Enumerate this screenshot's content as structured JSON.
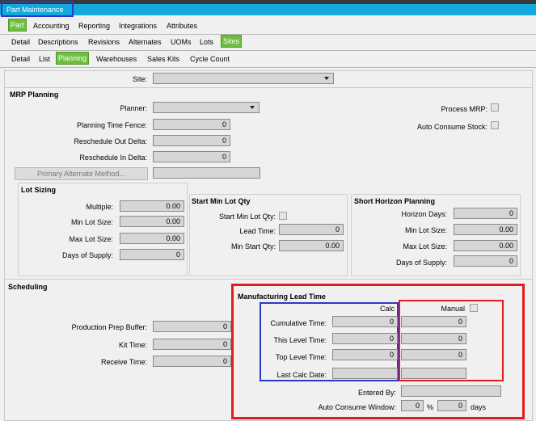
{
  "window": {
    "title": "Part Maintenance"
  },
  "tabs_level1": [
    "Part",
    "Accounting",
    "Reporting",
    "Integrations",
    "Attributes"
  ],
  "tabs_level2": [
    "Detail",
    "Descriptions",
    "Revisions",
    "Alternates",
    "UOMs",
    "Lots",
    "Sites"
  ],
  "tabs_level3": [
    "Detail",
    "List",
    "Planning",
    "Warehouses",
    "Sales Kits",
    "Cycle Count"
  ],
  "site": {
    "label": "Site:",
    "value": ""
  },
  "mrp": {
    "section": "MRP Planning",
    "planner_label": "Planner:",
    "planning_time_fence_label": "Planning Time Fence:",
    "planning_time_fence": "0",
    "reschedule_out_label": "Reschedule Out Delta:",
    "reschedule_out": "0",
    "reschedule_in_label": "Reschedule In Delta:",
    "reschedule_in": "0",
    "primary_alt_button": "Primary Alternate Method...",
    "process_mrp_label": "Process MRP:",
    "auto_consume_label": "Auto Consume Stock:"
  },
  "lot_sizing": {
    "section": "Lot Sizing",
    "multiple_label": "Multiple:",
    "multiple": "0.00",
    "min_lot_label": "Min Lot Size:",
    "min_lot": "0.00",
    "max_lot_label": "Max Lot Size:",
    "max_lot": "0.00",
    "days_supply_label": "Days of Supply:",
    "days_supply": "0"
  },
  "start_min": {
    "section": "Start Min Lot Qty",
    "start_min_label": "Start Min Lot Qty:",
    "lead_time_label": "Lead Time:",
    "lead_time": "0",
    "min_start_label": "Min Start Qty:",
    "min_start": "0.00"
  },
  "short_horizon": {
    "section": "Short Horizon Planning",
    "horizon_label": "Horizon Days:",
    "horizon": "0",
    "min_lot_label": "Min Lot Size:",
    "min_lot": "0.00",
    "max_lot_label": "Max Lot Size:",
    "max_lot": "0.00",
    "days_supply_label": "Days of Supply:",
    "days_supply": "0"
  },
  "scheduling": {
    "section": "Scheduling",
    "prod_prep_label": "Production Prep Buffer:",
    "prod_prep": "0",
    "kit_time_label": "Kit Time:",
    "kit_time": "0",
    "receive_time_label": "Receive Time:",
    "receive_time": "0"
  },
  "mfg_lead": {
    "section": "Manufacturing Lead Time",
    "calc_label": "Calc",
    "manual_label": "Manual",
    "cumulative_label": "Cumulative Time:",
    "cumulative_calc": "0",
    "cumulative_manual": "0",
    "this_level_label": "This Level Time:",
    "this_level_calc": "0",
    "this_level_manual": "0",
    "top_level_label": "Top Level Time:",
    "top_level_calc": "0",
    "top_level_manual": "0",
    "last_calc_label": "Last Calc Date:",
    "entered_by_label": "Entered By:",
    "auto_consume_window_label": "Auto Consume Window:",
    "auto_consume_pct": "0",
    "pct_symbol": "%",
    "auto_consume_days": "0",
    "days_label": "days"
  },
  "colors": {
    "title_bar": "#14a9dc",
    "active_tab": "#6cbf3f",
    "highlight_red": "#e21b1b",
    "highlight_blue": "#2a39c9"
  }
}
